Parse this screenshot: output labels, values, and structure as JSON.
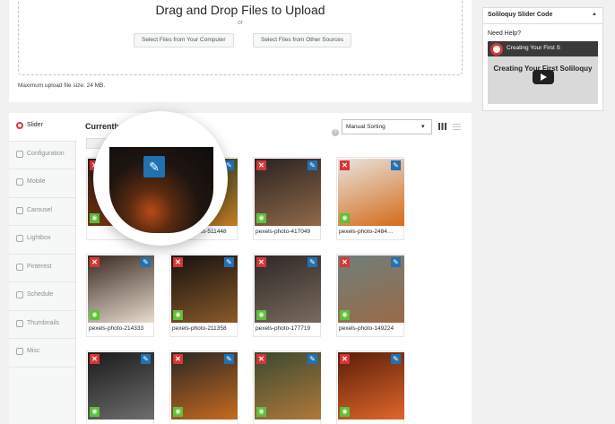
{
  "upload": {
    "title": "Drag and Drop Files to Upload",
    "or": "or",
    "select_computer": "Select Files from Your Computer",
    "select_other": "Select Files from Other Sources",
    "max_size": "Maximum upload file size: 24 MB."
  },
  "sidebar": {
    "title": "Soliloquy Slider Code",
    "toggle": "▲",
    "need_help": "Need Help?",
    "video_top": "Creating Your First S",
    "video_title": "Creating Your First Soliloquy Slider"
  },
  "tabs": [
    {
      "label": "Slider",
      "active": true
    },
    {
      "label": "Configuration"
    },
    {
      "label": "Mobile"
    },
    {
      "label": "Carousel"
    },
    {
      "label": "Lightbox"
    },
    {
      "label": "Pinterest"
    },
    {
      "label": "Schedule"
    },
    {
      "label": "Thumbnails"
    },
    {
      "label": "Misc"
    }
  ],
  "main": {
    "title": "Currently",
    "sort": "Manual Sorting",
    "help": "?"
  },
  "glyphs": {
    "delete": "✕",
    "edit": "✎",
    "view": "◉"
  },
  "images": [
    {
      "label": "",
      "colors": [
        "#2a1c14",
        "#8c3a12"
      ]
    },
    {
      "label": "pexels-photo-511448",
      "colors": [
        "#1f3d2a",
        "#c27a24"
      ]
    },
    {
      "label": "pexels-photo-417049",
      "colors": [
        "#2b2220",
        "#8f6a4a"
      ]
    },
    {
      "label": "pexels-photo-2484…",
      "colors": [
        "#e8e4de",
        "#d46b1a"
      ]
    },
    {
      "label": "pexels-photo-214333",
      "colors": [
        "#3a2a22",
        "#e7dccd"
      ]
    },
    {
      "label": "pexels-photo-211358",
      "colors": [
        "#14110f",
        "#8a5a2a"
      ]
    },
    {
      "label": "pexels-photo-177719",
      "colors": [
        "#2d2825",
        "#7a6a5e"
      ]
    },
    {
      "label": "pexels-photo-149224",
      "colors": [
        "#6f7f7a",
        "#9b6a48"
      ]
    },
    {
      "label": "",
      "colors": [
        "#1a1a1a",
        "#6e6e6e"
      ]
    },
    {
      "label": "",
      "colors": [
        "#2a2724",
        "#c76a1e"
      ]
    },
    {
      "label": "",
      "colors": [
        "#3a4a30",
        "#b0783a"
      ]
    },
    {
      "label": "",
      "colors": [
        "#5a1e0a",
        "#e0672a"
      ]
    }
  ]
}
